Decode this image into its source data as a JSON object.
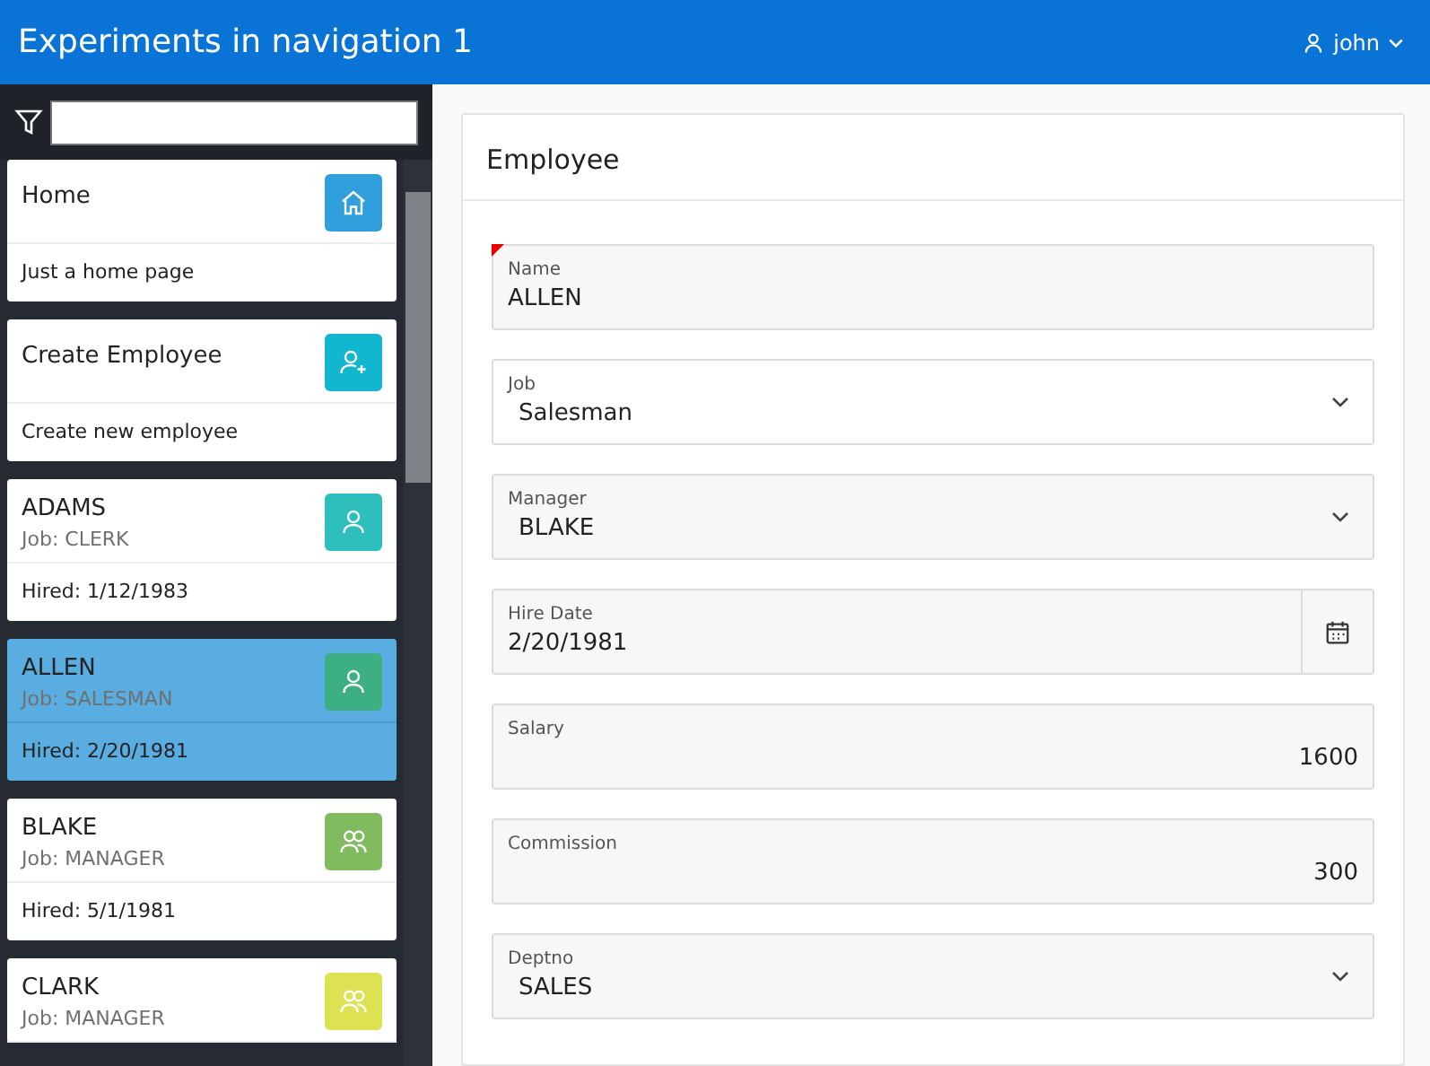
{
  "header": {
    "title": "Experiments in navigation 1",
    "user": "john"
  },
  "nav_cards": [
    {
      "kind": "home",
      "title": "Home",
      "footer": "Just a home page",
      "color": "#309fdb",
      "selected": false
    },
    {
      "kind": "add-user",
      "title": "Create Employee",
      "footer": "Create new employee",
      "color": "#13b6cf",
      "selected": false
    },
    {
      "kind": "user",
      "title": "ADAMS",
      "subtitle": "Job: CLERK",
      "footer": "Hired: 1/12/1983",
      "color": "#2ebfbc",
      "selected": false
    },
    {
      "kind": "user",
      "title": "ALLEN",
      "subtitle": "Job: SALESMAN",
      "footer": "Hired: 2/20/1981",
      "color": "#3cb082",
      "selected": true
    },
    {
      "kind": "users",
      "title": "BLAKE",
      "subtitle": "Job: MANAGER",
      "footer": "Hired: 5/1/1981",
      "color": "#81bb5f",
      "selected": false
    },
    {
      "kind": "users",
      "title": "CLARK",
      "subtitle": "Job: MANAGER",
      "color": "#dde253",
      "selected": false
    }
  ],
  "form": {
    "title": "Employee",
    "fields": [
      {
        "kind": "text",
        "label": "Name",
        "value": "ALLEN",
        "required": true,
        "focused": false
      },
      {
        "kind": "select",
        "label": "Job",
        "value": "Salesman",
        "required": false,
        "focused": true
      },
      {
        "kind": "select",
        "label": "Manager",
        "value": "BLAKE",
        "required": false,
        "focused": false
      },
      {
        "kind": "date",
        "label": "Hire Date",
        "value": "2/20/1981",
        "required": false,
        "focused": false
      },
      {
        "kind": "number",
        "label": "Salary",
        "value": "1600",
        "required": false,
        "focused": false
      },
      {
        "kind": "number",
        "label": "Commission",
        "value": "300",
        "required": false,
        "focused": false
      },
      {
        "kind": "select",
        "label": "Deptno",
        "value": "SALES",
        "required": false,
        "focused": false
      }
    ]
  }
}
